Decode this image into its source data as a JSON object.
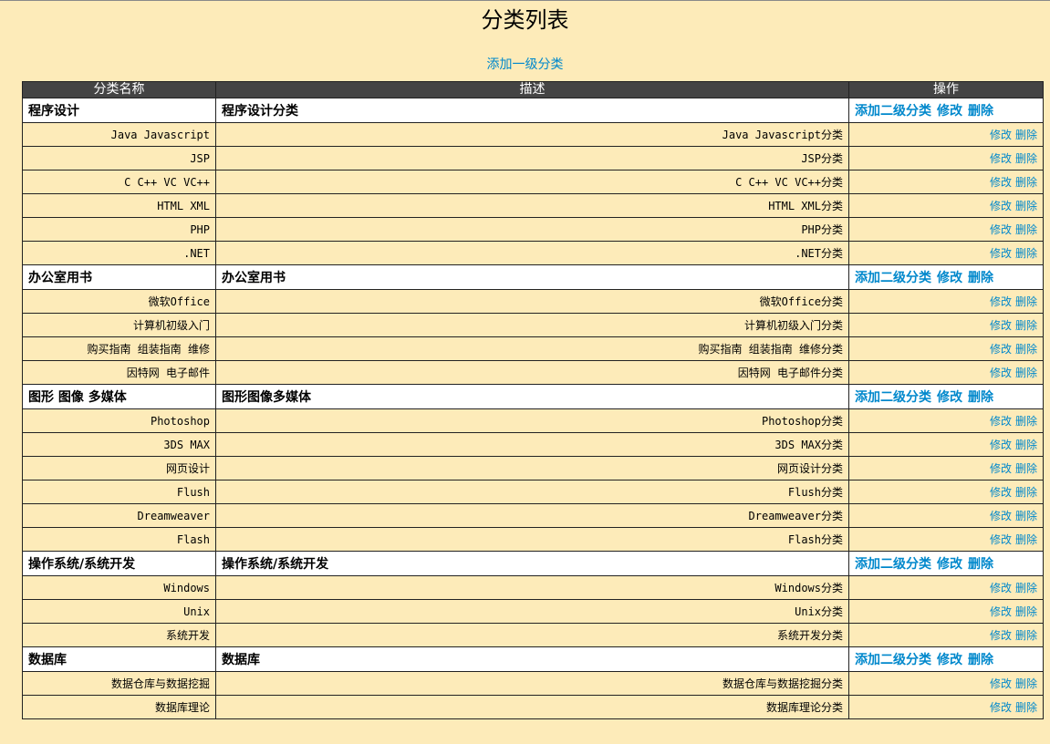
{
  "page": {
    "title": "分类列表",
    "add_top": "添加一级分类"
  },
  "table": {
    "headers": [
      "分类名称",
      "描述",
      "操作"
    ],
    "actions": {
      "add_sub": "添加二级分类",
      "edit": "修改",
      "del": "删除"
    },
    "rows": [
      {
        "level": 1,
        "name": "程序设计",
        "desc": "程序设计分类"
      },
      {
        "level": 2,
        "name": "Java Javascript",
        "desc": "Java Javascript分类"
      },
      {
        "level": 2,
        "name": "JSP",
        "desc": "JSP分类"
      },
      {
        "level": 2,
        "name": "C C++ VC VC++",
        "desc": "C C++ VC VC++分类"
      },
      {
        "level": 2,
        "name": "HTML XML",
        "desc": "HTML XML分类"
      },
      {
        "level": 2,
        "name": "PHP",
        "desc": "PHP分类"
      },
      {
        "level": 2,
        "name": ".NET",
        "desc": ".NET分类"
      },
      {
        "level": 1,
        "name": "办公室用书",
        "desc": "办公室用书"
      },
      {
        "level": 2,
        "name": "微软Office",
        "desc": "微软Office分类"
      },
      {
        "level": 2,
        "name": "计算机初级入门",
        "desc": "计算机初级入门分类"
      },
      {
        "level": 2,
        "name": "购买指南 组装指南 维修",
        "desc": "购买指南 组装指南 维修分类"
      },
      {
        "level": 2,
        "name": "因特网 电子邮件",
        "desc": "因特网 电子邮件分类"
      },
      {
        "level": 1,
        "name": "图形 图像 多媒体",
        "desc": "图形图像多媒体"
      },
      {
        "level": 2,
        "name": "Photoshop",
        "desc": "Photoshop分类"
      },
      {
        "level": 2,
        "name": "3DS MAX",
        "desc": "3DS MAX分类"
      },
      {
        "level": 2,
        "name": "网页设计",
        "desc": "网页设计分类"
      },
      {
        "level": 2,
        "name": "Flush",
        "desc": "Flush分类"
      },
      {
        "level": 2,
        "name": "Dreamweaver",
        "desc": "Dreamweaver分类"
      },
      {
        "level": 2,
        "name": "Flash",
        "desc": "Flash分类"
      },
      {
        "level": 1,
        "name": "操作系统/系统开发",
        "desc": "操作系统/系统开发"
      },
      {
        "level": 2,
        "name": "Windows",
        "desc": "Windows分类"
      },
      {
        "level": 2,
        "name": "Unix",
        "desc": "Unix分类"
      },
      {
        "level": 2,
        "name": "系统开发",
        "desc": "系统开发分类"
      },
      {
        "level": 1,
        "name": "数据库",
        "desc": "数据库"
      },
      {
        "level": 2,
        "name": "数据仓库与数据挖掘",
        "desc": "数据仓库与数据挖掘分类"
      },
      {
        "level": 2,
        "name": "数据库理论",
        "desc": "数据库理论分类"
      }
    ]
  },
  "colors": {
    "background": "#fdebb9",
    "header_bg": "#444444",
    "link": "#0088cc",
    "level1_bg": "#ffffff"
  }
}
